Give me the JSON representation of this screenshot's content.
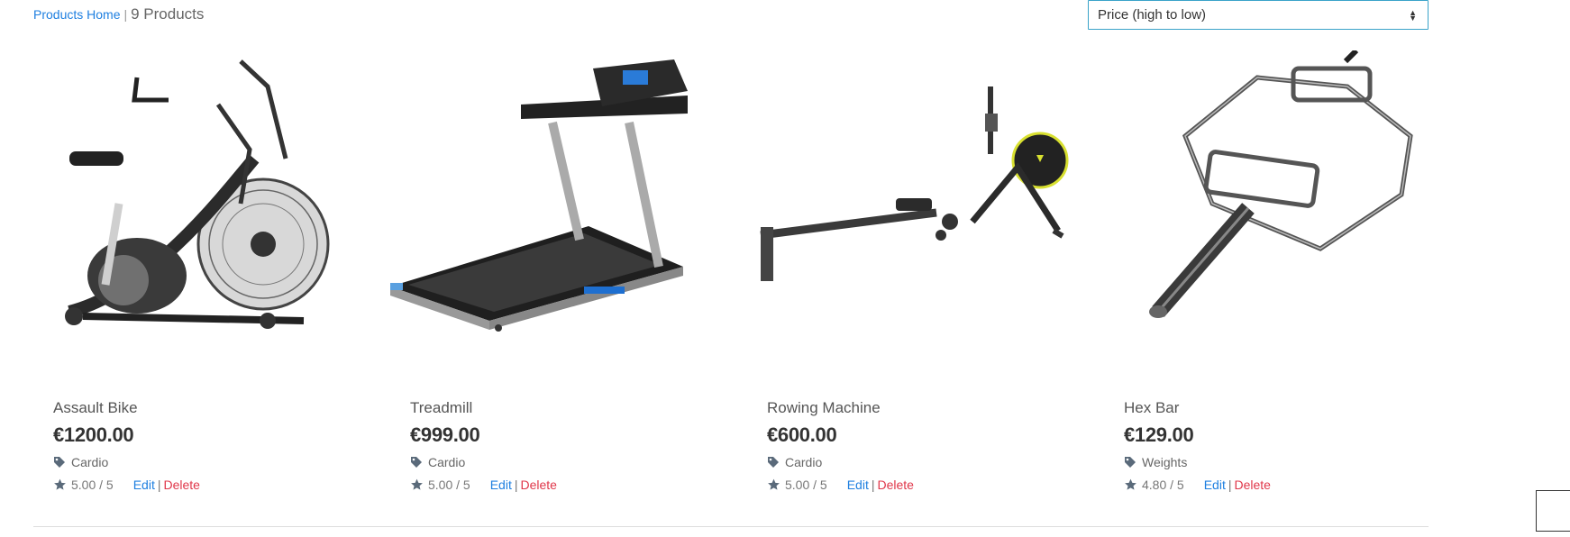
{
  "breadcrumb": {
    "home_label": "Products Home",
    "separator": "|",
    "count_label": "9 Products"
  },
  "sort": {
    "selected": "Price (high to low)"
  },
  "products": [
    {
      "name": "Assault Bike",
      "price": "€1200.00",
      "category": "Cardio",
      "rating": "5.00 / 5",
      "edit": "Edit",
      "delete": "Delete",
      "image_icon": "air-bike-image"
    },
    {
      "name": "Treadmill",
      "price": "€999.00",
      "category": "Cardio",
      "rating": "5.00 / 5",
      "edit": "Edit",
      "delete": "Delete",
      "image_icon": "treadmill-image"
    },
    {
      "name": "Rowing Machine",
      "price": "€600.00",
      "category": "Cardio",
      "rating": "5.00 / 5",
      "edit": "Edit",
      "delete": "Delete",
      "image_icon": "rowing-machine-image"
    },
    {
      "name": "Hex Bar",
      "price": "€129.00",
      "category": "Weights",
      "rating": "4.80 / 5",
      "edit": "Edit",
      "delete": "Delete",
      "image_icon": "hex-bar-image"
    }
  ],
  "colors": {
    "link": "#1e7fe0",
    "delete": "#e0374a",
    "select_border": "#3aa3c9"
  }
}
